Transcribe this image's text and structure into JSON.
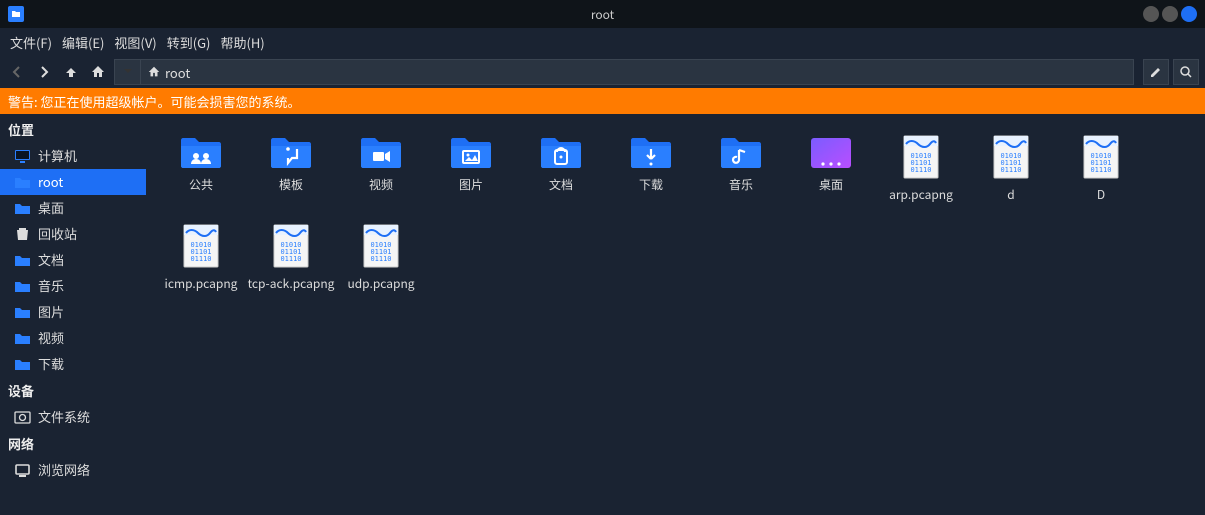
{
  "window": {
    "title": "root"
  },
  "menubar": {
    "items": [
      "文件(F)",
      "编辑(E)",
      "视图(V)",
      "转到(G)",
      "帮助(H)"
    ]
  },
  "path": {
    "label": "root"
  },
  "warning": {
    "text": "警告: 您正在使用超级帐户。可能会损害您的系统。"
  },
  "sidebar": {
    "sections": {
      "places": {
        "header": "位置",
        "items": [
          {
            "label": "计算机",
            "icon": "monitor",
            "selected": false
          },
          {
            "label": "root",
            "icon": "folder",
            "selected": true
          },
          {
            "label": "桌面",
            "icon": "folder",
            "selected": false
          },
          {
            "label": "回收站",
            "icon": "trash",
            "selected": false
          },
          {
            "label": "文档",
            "icon": "folder",
            "selected": false
          },
          {
            "label": "音乐",
            "icon": "folder",
            "selected": false
          },
          {
            "label": "图片",
            "icon": "folder",
            "selected": false
          },
          {
            "label": "视频",
            "icon": "folder",
            "selected": false
          },
          {
            "label": "下载",
            "icon": "folder",
            "selected": false
          }
        ]
      },
      "devices": {
        "header": "设备",
        "items": [
          {
            "label": "文件系统",
            "icon": "disk",
            "selected": false
          }
        ]
      },
      "network": {
        "header": "网络",
        "items": [
          {
            "label": "浏览网络",
            "icon": "network",
            "selected": false
          }
        ]
      }
    }
  },
  "content": {
    "items": [
      {
        "type": "folder",
        "glyph": "people",
        "label": "公共"
      },
      {
        "type": "folder",
        "glyph": "template",
        "label": "模板"
      },
      {
        "type": "folder",
        "glyph": "video",
        "label": "视频"
      },
      {
        "type": "folder",
        "glyph": "image",
        "label": "图片"
      },
      {
        "type": "folder",
        "glyph": "document",
        "label": "文档"
      },
      {
        "type": "folder",
        "glyph": "download",
        "label": "下载"
      },
      {
        "type": "folder",
        "glyph": "music",
        "label": "音乐"
      },
      {
        "type": "desktop",
        "glyph": "desktop",
        "label": "桌面"
      },
      {
        "type": "pcap",
        "glyph": "pcap",
        "label": "arp.pcapng"
      },
      {
        "type": "pcap",
        "glyph": "pcap",
        "label": "d"
      },
      {
        "type": "pcap",
        "glyph": "pcap",
        "label": "D"
      },
      {
        "type": "pcap",
        "glyph": "pcap",
        "label": "icmp.pcapng"
      },
      {
        "type": "pcap",
        "glyph": "pcap",
        "label": "tcp-ack.pcapng"
      },
      {
        "type": "pcap",
        "glyph": "pcap",
        "label": "udp.pcapng"
      }
    ]
  },
  "colors": {
    "folder": "#2a7fff",
    "folder_dark": "#1e6ff5",
    "warning_bg": "#ff7b00"
  }
}
